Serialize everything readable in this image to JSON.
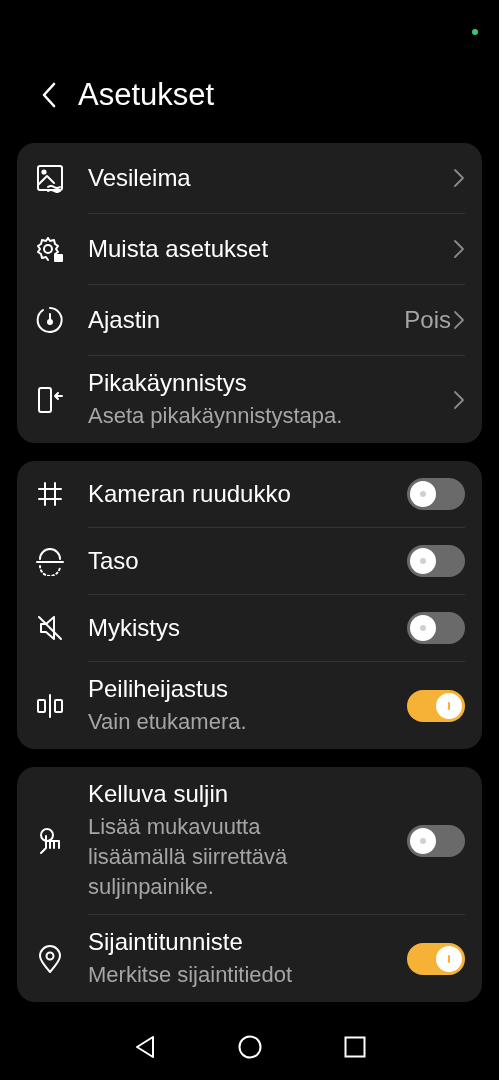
{
  "header": {
    "title": "Asetukset"
  },
  "groups": [
    {
      "items": [
        {
          "kind": "link",
          "title": "Vesileima"
        },
        {
          "kind": "link",
          "title": "Muista asetukset"
        },
        {
          "kind": "link",
          "title": "Ajastin",
          "value": "Pois"
        },
        {
          "kind": "link",
          "title": "Pikakäynnistys",
          "subtitle": "Aseta pikakäynnistystapa."
        }
      ]
    },
    {
      "items": [
        {
          "kind": "switch",
          "title": "Kameran ruudukko",
          "on": false
        },
        {
          "kind": "switch",
          "title": "Taso",
          "on": false
        },
        {
          "kind": "switch",
          "title": "Mykistys",
          "on": false
        },
        {
          "kind": "switch",
          "title": "Peiliheijastus",
          "subtitle": "Vain etukamera.",
          "on": true
        }
      ]
    },
    {
      "items": [
        {
          "kind": "switch",
          "title": "Kelluva suljin",
          "subtitle": "Lisää mukavuutta lisäämällä siirrettävä suljinpainike.",
          "on": false
        },
        {
          "kind": "switch",
          "title": "Sijaintitunniste",
          "subtitle": "Merkitse sijaintitiedot",
          "on": true
        }
      ]
    }
  ]
}
